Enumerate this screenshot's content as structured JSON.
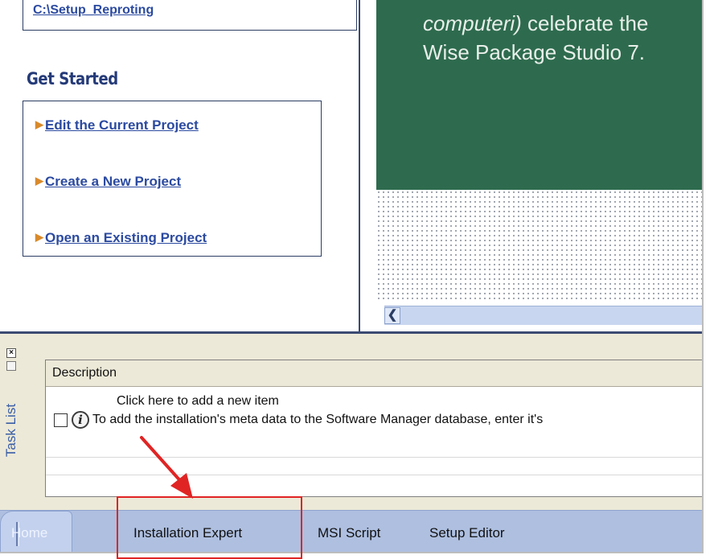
{
  "left_pane": {
    "recent_link": "C:\\Setup_Reproting",
    "get_started_heading": "Get Started",
    "project_links": [
      {
        "label": "Edit the Current Project"
      },
      {
        "label": "Create a New Project"
      },
      {
        "label": "Open an Existing Project"
      }
    ]
  },
  "right_pane": {
    "banner_line1_italic": "computeri)",
    "banner_line1_rest": " celebrate the",
    "banner_line2": "Wise Package Studio 7."
  },
  "task_list": {
    "panel_title": "Task List",
    "column_header": "Description",
    "add_item_text": "Click here to add a new item",
    "items": [
      {
        "text": "To add the installation's meta data to the Software Manager database, enter it's",
        "checked": false
      }
    ]
  },
  "tabs": [
    {
      "label": "Home"
    },
    {
      "label": "Installation Expert"
    },
    {
      "label": "MSI Script"
    },
    {
      "label": "Setup Editor"
    }
  ],
  "annotation": {
    "highlight_color": "#e02424",
    "highlighted_tab": "Installation Expert"
  },
  "colors": {
    "banner_green": "#2e6b4e",
    "link_blue": "#2b4aa0",
    "tab_bar": "#aebfe0"
  }
}
